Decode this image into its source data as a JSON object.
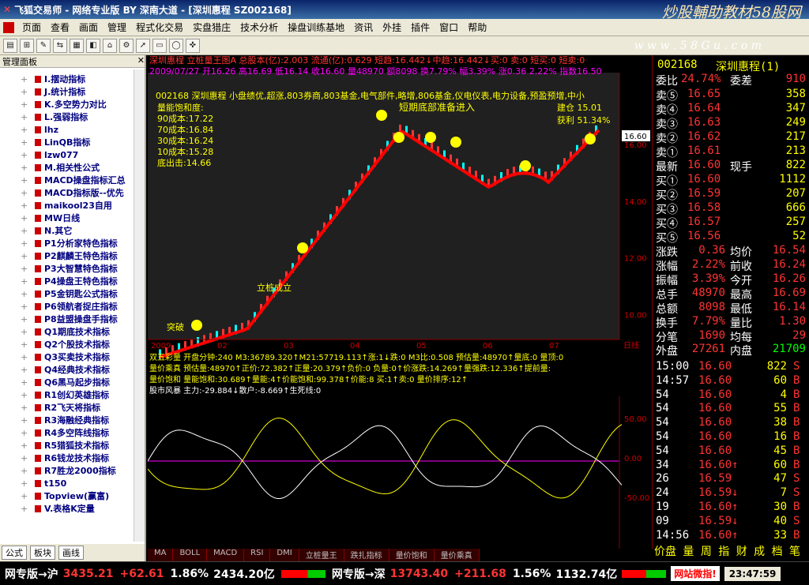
{
  "title": "飞狐交易师 - 网络专业版 BY 深南大道 - [深圳惠程 SZ002168]",
  "promo": "炒股輔助教材58股网",
  "promo_url": "w w w . 5 8 G u . c o m",
  "menu": [
    "页面",
    "查看",
    "画面",
    "管理",
    "程式化交易",
    "实盘猎庄",
    "技术分析",
    "操盘训练基地",
    "资讯",
    "外挂",
    "插件",
    "窗口",
    "帮助"
  ],
  "left": {
    "title": "管理面板",
    "items": [
      "I.摆动指标",
      "J.统计指标",
      "K.多空势力对比",
      "L.强弱指标",
      "lhz",
      "LinQB指标",
      "lzw077",
      "M.相关性公式",
      "MACD操盘指标汇总",
      "MACD指标版--优先",
      "maikool23自用",
      "MW日线",
      "N.其它",
      "P1分析家特色指标",
      "P2麒麟王特色指标",
      "P3大智慧特色指标",
      "P4操盘王特色指标",
      "P5金钥匙公式指标",
      "P6领航者捉庄指标",
      "P8益盟操盘手指标",
      "Q1期底技术指标",
      "Q2个股技术指标",
      "Q3买卖技术指标",
      "Q4经典技术指标",
      "Q6黑马起步指标",
      "R1创幻英雄指标",
      "R2飞天将指标",
      "R3海融经典指标",
      "R4多空阵线指标",
      "R5猎狐技术指标",
      "R6钱龙技术指标",
      "R7胜龙2000指标",
      "t150",
      "Topview(赢富)",
      "V.表格K定量"
    ],
    "tabs": [
      "公式",
      "板块",
      "画线"
    ]
  },
  "chart": {
    "header1": "深圳惠程 立桩量王图A 总股本(亿):2.003 流通(亿):0.629 短趋:16.442↓中趋:16.442↓买:0 卖:0 短买:0 短卖:0",
    "header2": "2009/07/27 开16.26 高16.69 低16.14 收16.60 量48970 额8098 换7.79% 幅3.39% 涨0.36 2.22% 指数16.50",
    "info": [
      "002168 深圳惠程 小盘绩优,超涨,803券商,803基金,电气部件,略增,806基金,仪电仪表,电力设备,预盈预增,中小"
    ],
    "costs": [
      "量能饱和度:",
      "90成本:17.22",
      "70成本:16.84",
      "30成本:16.24",
      "10成本:15.28",
      "底出击:14.66"
    ],
    "annotations": [
      "短期底部准备进入",
      "建仓 15.01",
      "获利 51.34%",
      "立桩成立",
      "突破"
    ],
    "months": [
      "2009",
      "02",
      "03",
      "04",
      "05",
      "06",
      "07"
    ],
    "period": "日线",
    "y_ticks": [
      "16.00",
      "14.00",
      "12.00",
      "10.00",
      "8.00"
    ],
    "last_price": "16.60",
    "ind1": "双五彩量 开盘分钟:240 M3:36789.320↑M21:57719.113↑涨:1↓跌:0 M3比:0.508 预估量:48970↑量底:0 量顶:0",
    "ind2": "量价乘真 预估量:48970↑正价:72.382↑正量:20.379↑负价:0 负量:0↑价涨跌:14.269↑量强跌:12.336↑提前量:",
    "ind3": "量价饱和 量能饱和:30.689↑量能:4↑价能饱和:99.378↑价能:8 买:1↑卖:0 量价排序:12↑",
    "ind4": "股市风暴 主力:-29.884↓散户:-8.669↑生死线:0",
    "ind4_ticks": [
      "50.00",
      "0.00",
      "-50.00"
    ],
    "tabs": [
      "MA",
      "BOLL",
      "MACD",
      "RSI",
      "DMI",
      "立桩量王",
      "跌扎指标",
      "量价饱和",
      "量价乘真"
    ],
    "chart_data": {
      "type": "line",
      "x": [
        "2009",
        "02",
        "03",
        "04",
        "05",
        "06",
        "07"
      ],
      "y_ticks": [
        8,
        10,
        12,
        14,
        16
      ],
      "last": 16.6
    }
  },
  "right": {
    "code": "002168",
    "name": "深圳惠程(1)",
    "weibi_label": "委比",
    "weibi": "24.74%",
    "weicha_label": "委差",
    "weicha": "910",
    "sells": [
      [
        "卖⑤",
        "16.65",
        "358"
      ],
      [
        "卖④",
        "16.64",
        "347"
      ],
      [
        "卖③",
        "16.63",
        "249"
      ],
      [
        "卖②",
        "16.62",
        "217"
      ],
      [
        "卖①",
        "16.61",
        "213"
      ]
    ],
    "latest": [
      "最新",
      "16.60",
      "现手",
      "822"
    ],
    "buys": [
      [
        "买①",
        "16.60",
        "1112"
      ],
      [
        "买②",
        "16.59",
        "207"
      ],
      [
        "买③",
        "16.58",
        "666"
      ],
      [
        "买④",
        "16.57",
        "257"
      ],
      [
        "买⑤",
        "16.56",
        "52"
      ]
    ],
    "stats": [
      [
        "涨跌",
        "0.36",
        "均价",
        "16.54"
      ],
      [
        "涨幅",
        "2.22%",
        "前收",
        "16.24"
      ],
      [
        "振幅",
        "3.39%",
        "今开",
        "16.26"
      ],
      [
        "总手",
        "48970",
        "最高",
        "16.69"
      ],
      [
        "总额",
        "8098",
        "最低",
        "16.14"
      ],
      [
        "换手",
        "7.79%",
        "量比",
        "1.30"
      ],
      [
        "分笔",
        "1690",
        "均每",
        "29"
      ]
    ],
    "outer": [
      "外盘",
      "27261",
      "内盘",
      "21709"
    ],
    "ticks": [
      [
        "15:00",
        "16.60",
        "822",
        "S"
      ],
      [
        "14:57",
        "16.60",
        "60",
        "B"
      ],
      [
        "54",
        "16.60",
        "4",
        "B"
      ],
      [
        "54",
        "16.60",
        "55",
        "B"
      ],
      [
        "54",
        "16.60",
        "38",
        "B"
      ],
      [
        "54",
        "16.60",
        "16",
        "B"
      ],
      [
        "54",
        "16.60",
        "45",
        "B"
      ],
      [
        "34",
        "16.60↑",
        "60",
        "B"
      ],
      [
        "26",
        "16.59",
        "47",
        "S"
      ],
      [
        "24",
        "16.59↓",
        "7",
        "S"
      ],
      [
        "19",
        "16.60↑",
        "30",
        "B"
      ],
      [
        "09",
        "16.59↓",
        "40",
        "S"
      ],
      [
        "14:56",
        "16.60↑",
        "33",
        "B"
      ]
    ],
    "bottom": "价盘 量 周 指 财 成 档 笔"
  },
  "status": {
    "sh_label": "网专版→沪",
    "sh": "3435.21",
    "sh_chg": "+62.61",
    "sh_pct": "1.86%",
    "sh_amt": "2434.20亿",
    "sz_label": "网专版→深",
    "sz": "13743.40",
    "sz_chg": "+211.68",
    "sz_pct": "1.56%",
    "sz_amt": "1132.74亿",
    "alert": "网站微指!",
    "time": "23:47:59"
  }
}
